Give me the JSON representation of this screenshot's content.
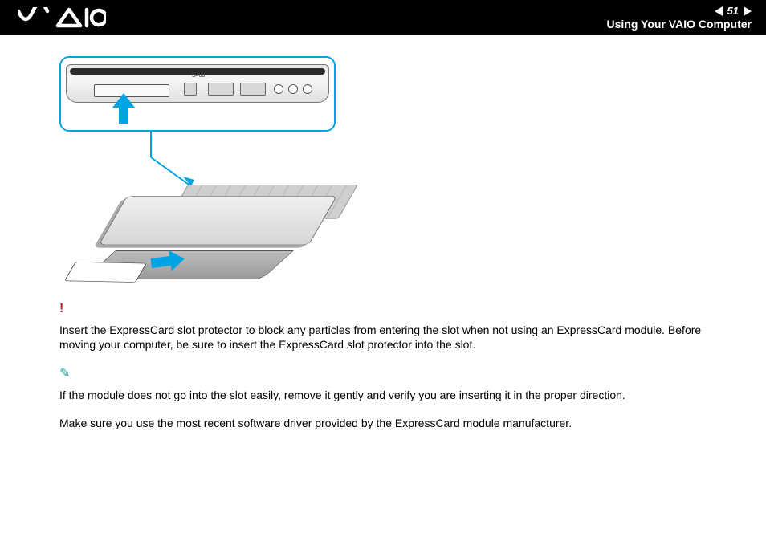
{
  "header": {
    "logo_text": "VAIO",
    "page_number": "51",
    "section_title": "Using Your VAIO Computer"
  },
  "figure": {
    "port_label": "S400"
  },
  "body": {
    "warning_text": "Insert the ExpressCard slot protector to block any particles from entering the slot when not using an ExpressCard module. Before moving your computer, be sure to insert the ExpressCard slot protector into the slot.",
    "note_text": "If the module does not go into the slot easily, remove it gently and verify you are inserting it in the proper direction.",
    "driver_text": "Make sure you use the most recent software driver provided by the ExpressCard module manufacturer."
  }
}
